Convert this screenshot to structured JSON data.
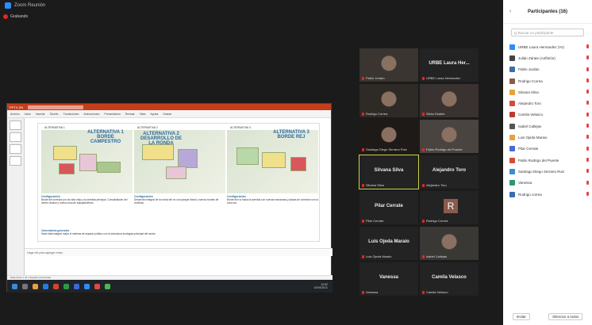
{
  "window": {
    "title": "Zoom Reunión",
    "minimize": "–",
    "maximize": "□"
  },
  "recording": {
    "label": "Grabando"
  },
  "share": {
    "app_title": "PPTX-0N",
    "ribbon_tabs": [
      "Archivo",
      "Inicio",
      "Insertar",
      "Diseño",
      "Transiciones",
      "Animaciones",
      "Presentación",
      "Revisar",
      "Vista",
      "Ayuda",
      "Grabar"
    ],
    "panels": [
      {
        "tag": "ALTERNATIVA 1",
        "headline": "ALTERNATIVA 1 BORDE CAMPESTRO",
        "sub": "Configuración",
        "body": "Borde del corredor por los sitio viejo y la avenida principal. Consolidación del centro urbano y nueva zona de equipamientos."
      },
      {
        "tag": "ALTERNATIVA 2",
        "headline": "ALTERNATIVA 2 DESARROLLO DE LA RONDA",
        "sub": "Configuración",
        "body": "Desarrollo integral de la ronda del río con parque lineal y nuevos bordes de vivienda."
      },
      {
        "tag": "ALTERNATIVA 3",
        "headline": "ALTERNATIVA 3 BORDE REJ",
        "sub": "Configuración",
        "body": "Borde del río hacia la avenida con nuevas manzanas y plazas de conexión con la zona sur."
      }
    ],
    "bottom_heading": "Comentarios generales",
    "bottom_body": "Hace falta integrar mejor el sistema de espacio público con la estructura ecológica principal del sector.",
    "notes": "Haga clic para agregar notas",
    "status": "Diapositiva 1 de 1   Español (Colombia)",
    "tray_time": "10:52",
    "tray_date": "10/04/2021"
  },
  "video_tiles": [
    {
      "name": "Pablo Jordan",
      "center": "",
      "type": "video"
    },
    {
      "name": "URBE Laura Hernandez",
      "center": "URBE Laura Her...",
      "type": "name"
    },
    {
      "name": "Rodrigo Correa",
      "center": "",
      "type": "video"
    },
    {
      "name": "Silvia Giraldo",
      "center": "",
      "type": "video"
    },
    {
      "name": "Santiago Diego Serrano Ruiz",
      "center": "",
      "type": "video"
    },
    {
      "name": "Pablo Rodrigo del Puente",
      "center": "",
      "type": "video"
    },
    {
      "name": "Silvana Silva",
      "center": "Silvana Silva",
      "type": "name",
      "active": true
    },
    {
      "name": "Alejandro Toro",
      "center": "Alejandro Toro",
      "type": "name"
    },
    {
      "name": "Pilar Cerrate",
      "center": "Pilar Cerrate",
      "type": "name"
    },
    {
      "name": "Rodrigo Correa",
      "center": "R",
      "type": "avatar"
    },
    {
      "name": "Luis Ojeda Maraio",
      "center": "Luis Ojeda Maraio",
      "type": "name"
    },
    {
      "name": "Isabel Callejas",
      "center": "",
      "type": "video"
    },
    {
      "name": "Vanessa",
      "center": "Vanessa",
      "type": "name"
    },
    {
      "name": "Camila Velasco",
      "center": "Camila Velasco",
      "type": "name"
    }
  ],
  "participants": {
    "title": "Participantes (16)",
    "search_placeholder": "Q Buscar un participante",
    "list": [
      {
        "name": "URBE Laura Hernandez (Yo)",
        "color": "#2d8cff"
      },
      {
        "name": "Julián Zárate (Anfitrión)",
        "color": "#444444"
      },
      {
        "name": "Pablo Jordan",
        "color": "#3a6db0"
      },
      {
        "name": "Rodrigo Correa",
        "color": "#8a5a4a"
      },
      {
        "name": "Silvana Silva",
        "color": "#e8a23a"
      },
      {
        "name": "Alejandro Toro",
        "color": "#d84a3a"
      },
      {
        "name": "Camila Velasco",
        "color": "#c0392b"
      },
      {
        "name": "Isabel Callejas",
        "color": "#555555"
      },
      {
        "name": "Luis Ojeda Maraio",
        "color": "#e8a23a"
      },
      {
        "name": "Pilar Cerrate",
        "color": "#4a6ad8"
      },
      {
        "name": "Pablo Rodrigo del Puente",
        "color": "#d84a3a"
      },
      {
        "name": "Santiago Diego Serrano Ruiz",
        "color": "#3a8ad8"
      },
      {
        "name": "Vanessa",
        "color": "#2a9a6a"
      },
      {
        "name": "Rodrigo correa",
        "color": "#3a6db0"
      }
    ],
    "invite_label": "Invitar",
    "mute_all_label": "Silenciar a todos"
  }
}
